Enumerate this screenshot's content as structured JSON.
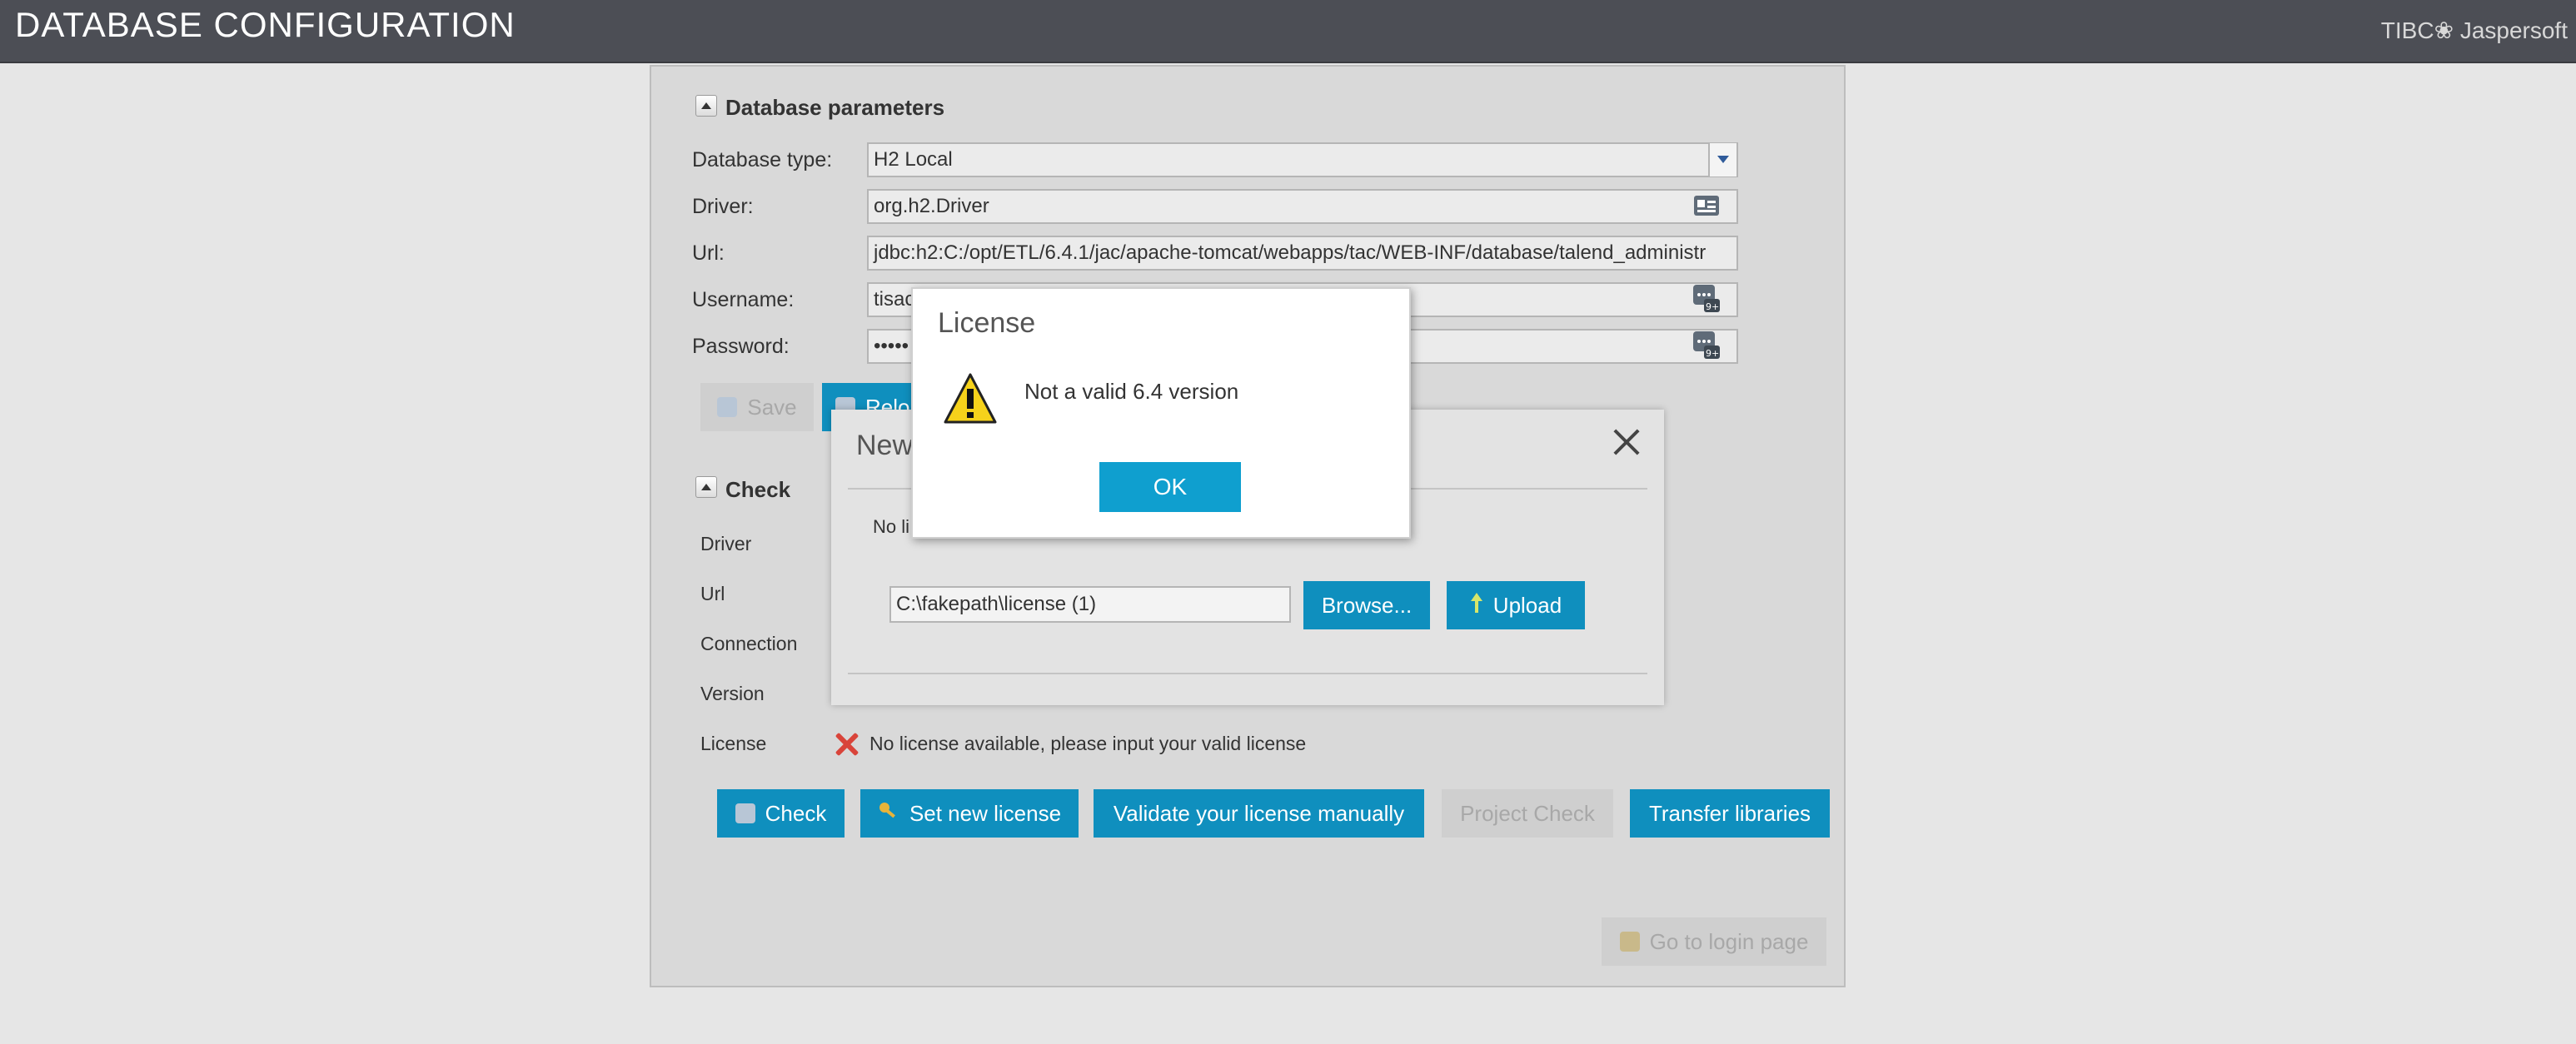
{
  "header": {
    "title": "DATABASE CONFIGURATION",
    "brand": "TIBC❀ Jaspersoft"
  },
  "db_params": {
    "section_title": "Database parameters",
    "database_type_label": "Database type:",
    "database_type_value": "H2 Local",
    "driver_label": "Driver:",
    "driver_value": "org.h2.Driver",
    "url_label": "Url:",
    "url_value": "jdbc:h2:C:/opt/ETL/6.4.1/jac/apache-tomcat/webapps/tac/WEB-INF/database/talend_administr",
    "username_label": "Username:",
    "username_value": "tisac",
    "password_label": "Password:",
    "password_value": "•••••",
    "save_label": "Save",
    "reload_label": "Relo"
  },
  "check": {
    "section_title": "Check",
    "rows": [
      "Driver",
      "Url",
      "Connection",
      "Version",
      "License"
    ],
    "license_status": "No license available, please input your valid license"
  },
  "actions": {
    "check_label": "Check",
    "set_license_label": "Set new license",
    "validate_label": "Validate your license manually",
    "project_check_label": "Project Check",
    "transfer_label": "Transfer libraries",
    "login_label": "Go to login page"
  },
  "new_license_dialog": {
    "title": "New",
    "status_text": "No li",
    "file_path": "C:\\fakepath\\license (1)",
    "browse_label": "Browse...",
    "upload_label": "Upload"
  },
  "alert": {
    "title": "License",
    "message": "Not a valid 6.4 version",
    "ok_label": "OK"
  },
  "colors": {
    "header_bg": "#4c4e55",
    "accent": "#0f8fbe",
    "error": "#d9443a"
  }
}
